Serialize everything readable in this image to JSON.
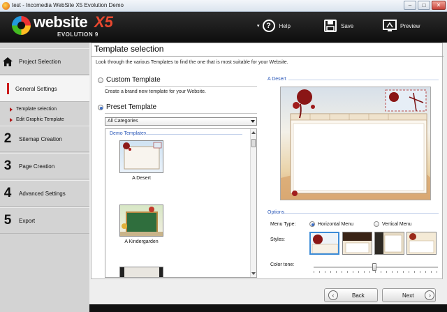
{
  "window": {
    "title": "test - Incomedia WebSite X5 Evolution Demo",
    "controls": {
      "minimize": "–",
      "maximize": "□",
      "close": "✕"
    }
  },
  "header": {
    "logo_word": "website",
    "logo_mark": "X5",
    "logo_edition": "EVOLUTION 9",
    "buttons": [
      {
        "label": "Help",
        "icon": "help-icon"
      },
      {
        "label": "Save",
        "icon": "save-icon"
      },
      {
        "label": "Preview",
        "icon": "preview-icon"
      }
    ]
  },
  "sidebar": {
    "steps": [
      {
        "num": "",
        "label": "Project Selection",
        "icon": "home-icon"
      },
      {
        "num": "",
        "label": "General Settings",
        "active": true
      },
      {
        "num": "2",
        "label": "Sitemap Creation"
      },
      {
        "num": "3",
        "label": "Page Creation"
      },
      {
        "num": "4",
        "label": "Advanced Settings"
      },
      {
        "num": "5",
        "label": "Export"
      }
    ],
    "subitems": [
      "Template selection",
      "Edit Graphic Template"
    ]
  },
  "panel": {
    "title": "Template selection",
    "intro": "Look through the various Templates to find the one that is most suitable for your Website.",
    "custom": {
      "label": "Custom Template",
      "desc": "Create a brand new template for your Website.",
      "selected": false
    },
    "preset": {
      "label": "Preset Template",
      "selected": true
    },
    "category_select": "All Categories",
    "group_label": "Demo Templates",
    "templates": [
      "A Desert",
      "A Kindergarden"
    ],
    "preview_label": "A Desert",
    "options_label": "Options",
    "menu_type_label": "Menu Type:",
    "menu_type_options": [
      {
        "label": "Horizontal Menu",
        "selected": true
      },
      {
        "label": "Vertical Menu",
        "selected": false
      }
    ],
    "styles_label": "Styles:",
    "color_tone_label": "Color tone:",
    "color_tone_value": 0.49
  },
  "footer": {
    "back": "Back",
    "next": "Next"
  },
  "colors": {
    "accent_red": "#cc1b1b",
    "link_blue": "#2b58b8",
    "selection_blue": "#3c8cd8"
  }
}
